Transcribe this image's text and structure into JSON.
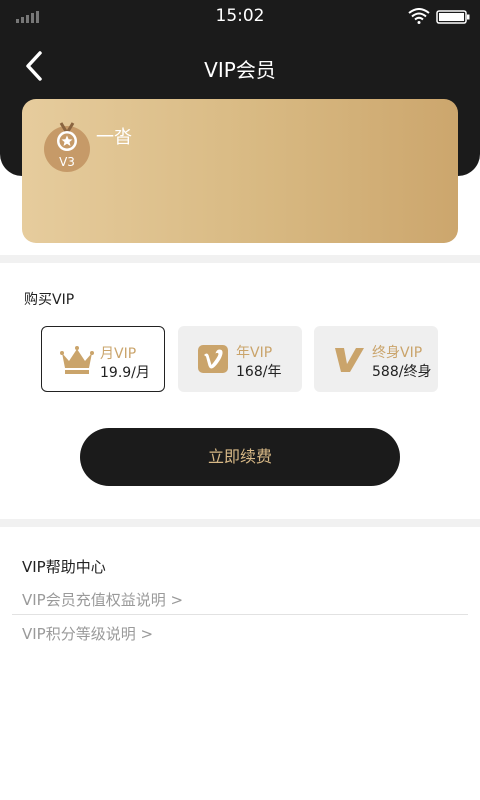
{
  "status_bar": {
    "time": "15:02"
  },
  "header": {
    "title": "VIP会员"
  },
  "card": {
    "username": "一沓",
    "level": "V3"
  },
  "purchase": {
    "title": "购买VIP",
    "plans": [
      {
        "name": "月VIP",
        "price": "19.9/月",
        "selected": true
      },
      {
        "name": "年VIP",
        "price": "168/年",
        "selected": false
      },
      {
        "name": "终身VIP",
        "price": "588/终身",
        "selected": false
      }
    ],
    "renew_label": "立即续费"
  },
  "help": {
    "title": "VIP帮助中心",
    "links": [
      "VIP会员充值权益说明 >",
      "VIP积分等级说明 >"
    ]
  },
  "colors": {
    "dark": "#1b1b1b",
    "gold": "#caa46b",
    "card_gold": "#d8b982"
  }
}
